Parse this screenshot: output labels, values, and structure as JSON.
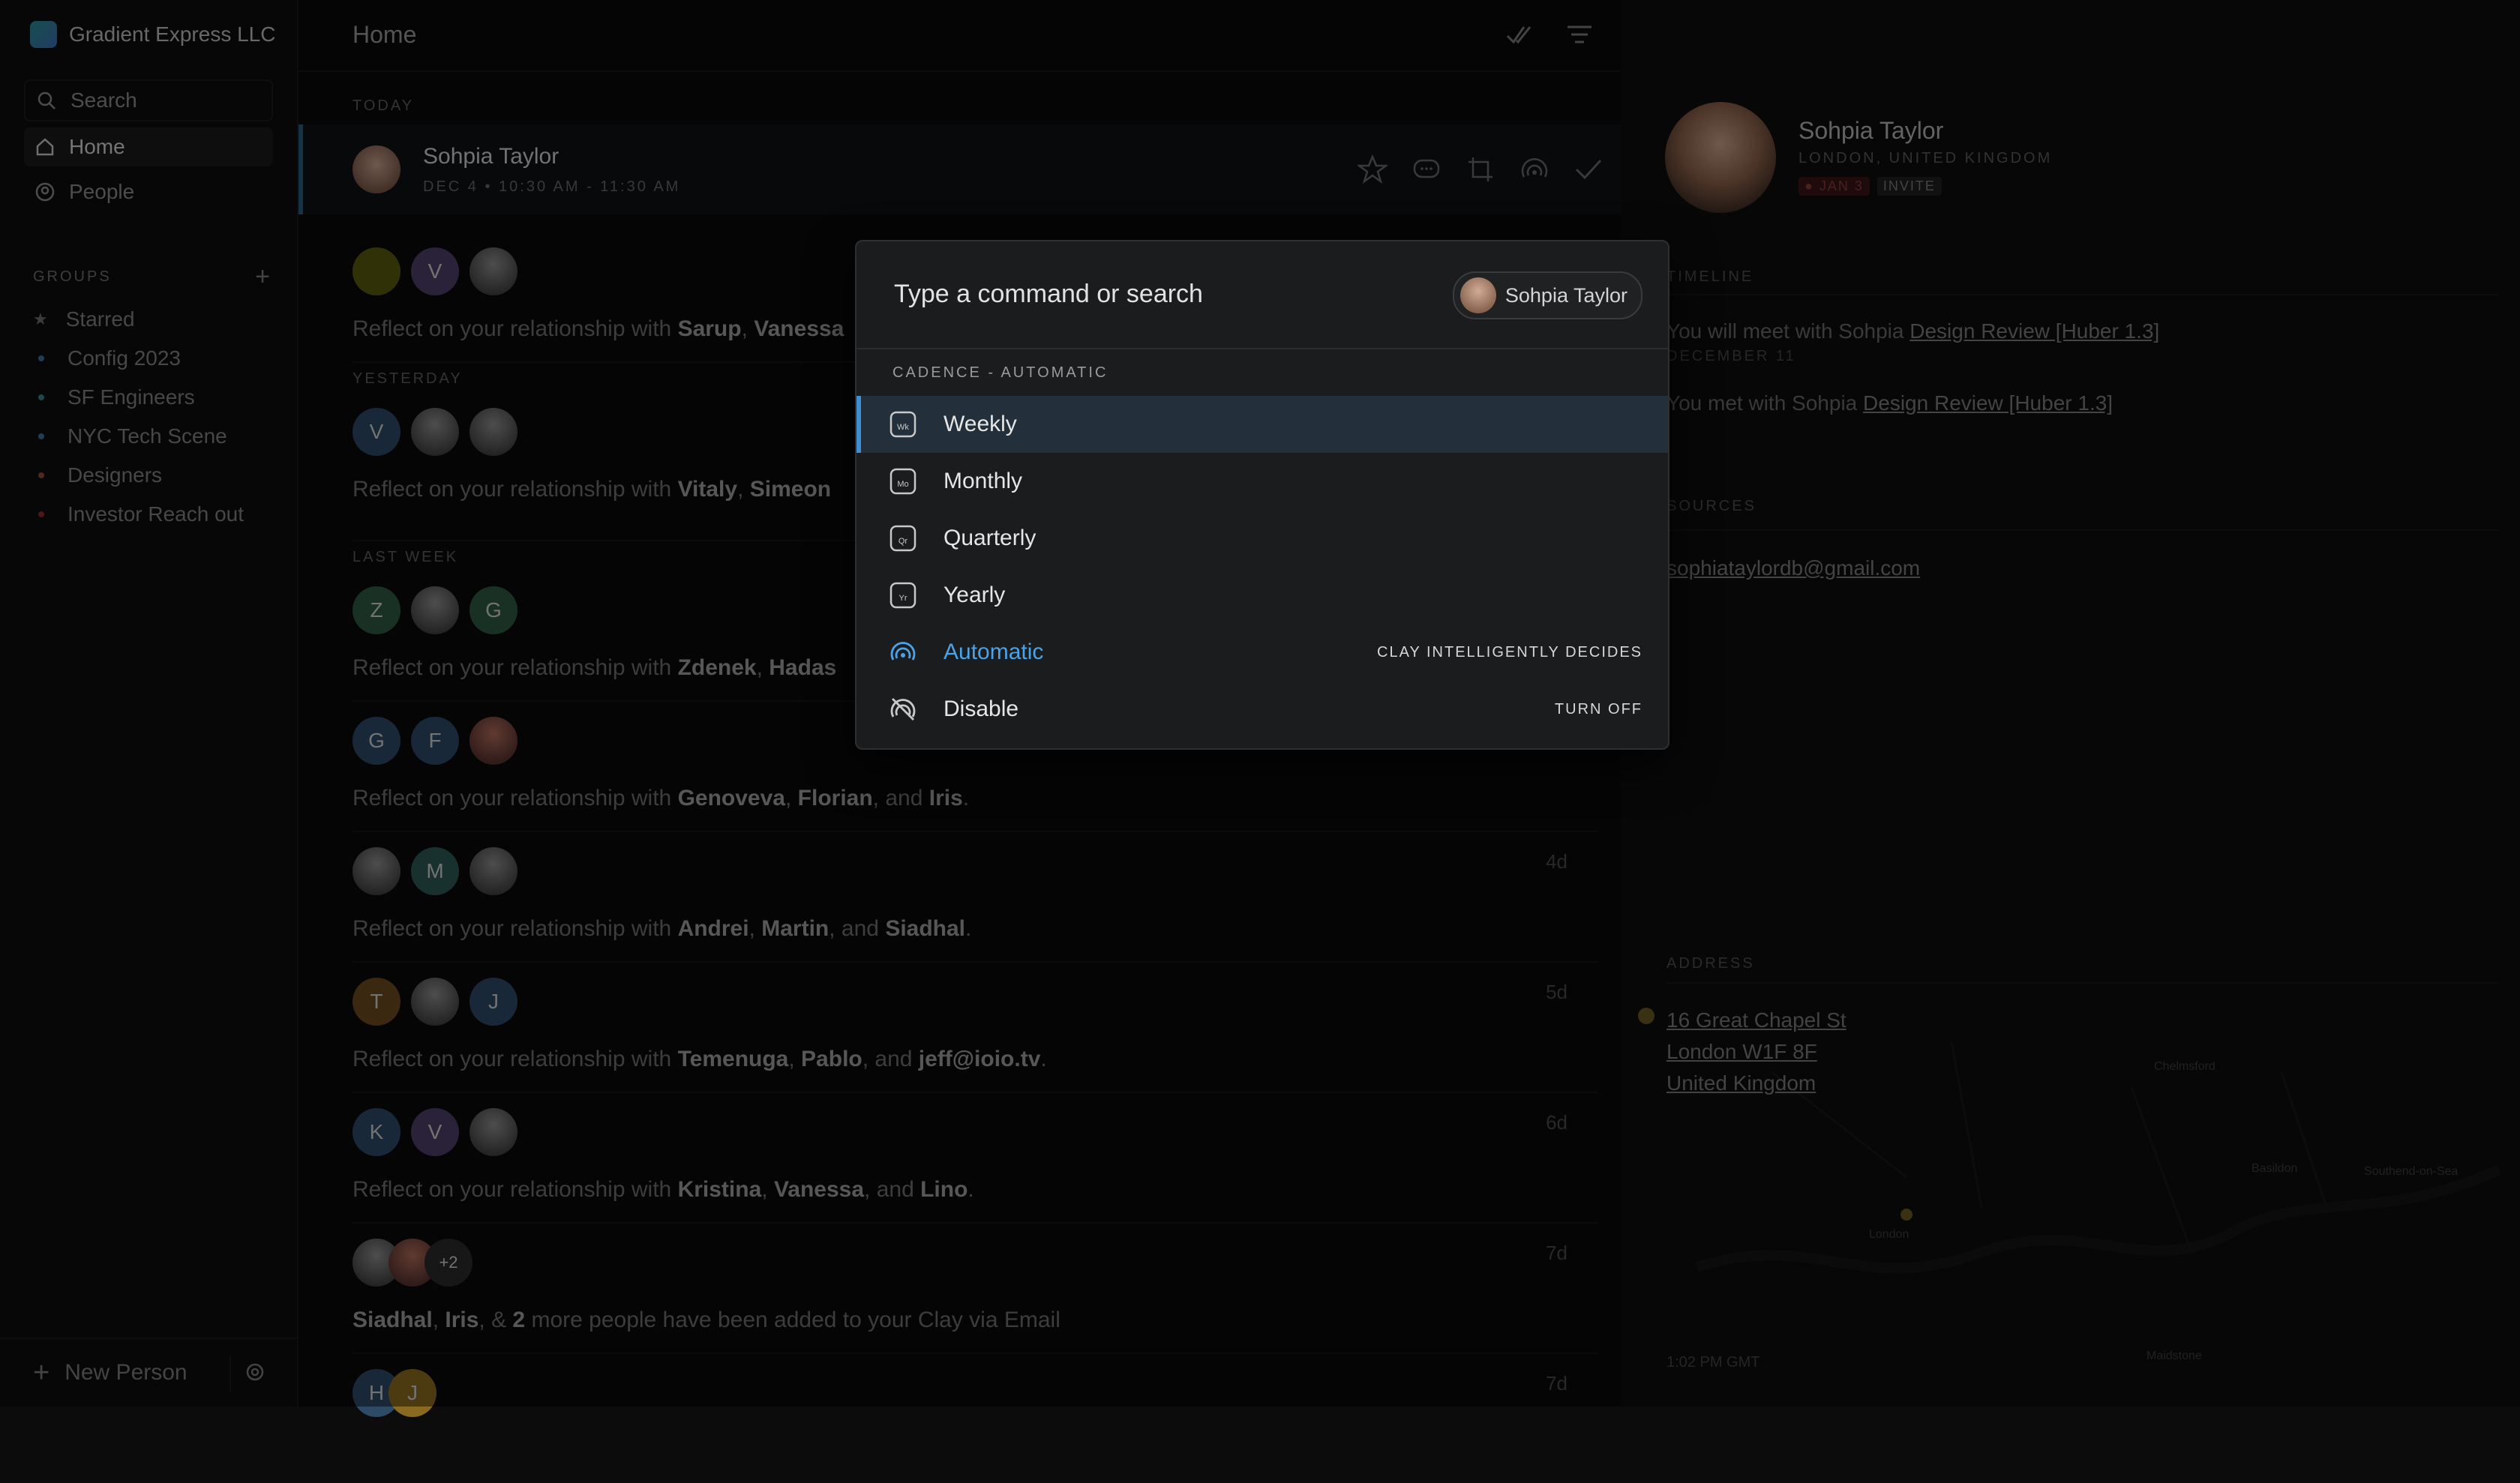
{
  "sidebar": {
    "brand": "Gradient Express LLC",
    "nav": [
      {
        "label": "Search",
        "icon": "search-icon"
      },
      {
        "label": "Home",
        "icon": "home-icon"
      },
      {
        "label": "People",
        "icon": "people-icon"
      }
    ],
    "groups_title": "GROUPS",
    "groups": [
      {
        "label": "Starred",
        "color": "#6e6e6e"
      },
      {
        "label": "Config 2023",
        "color": "#3b6fa0"
      },
      {
        "label": "SF Engineers",
        "color": "#3b7f8f"
      },
      {
        "label": "NYC Tech Scene",
        "color": "#3f6f9a"
      },
      {
        "label": "Designers",
        "color": "#8a4a3a"
      },
      {
        "label": "Investor Reach out",
        "color": "#8a2a2a"
      }
    ],
    "new_person": "New Person"
  },
  "header": {
    "title": "Home"
  },
  "feed": {
    "today_label": "TODAY",
    "today": {
      "name": "Sohpia Taylor",
      "time": "DEC 4 • 10:30 AM - 11:30 AM"
    },
    "items": [
      {
        "prefix": "Reflect on your relationship with",
        "n1": "Sarup",
        "n2": "Vanessa",
        "n3": "",
        "age": "",
        "avatars": [
          "",
          "V",
          ""
        ]
      },
      {
        "section": "YESTERDAY",
        "prefix": "Reflect on your relationship with",
        "n1": "Vitaly",
        "n2": "Simeon",
        "n3": "",
        "age": "",
        "avatars": [
          "V",
          "",
          ""
        ]
      },
      {
        "section": "LAST WEEK",
        "prefix": "Reflect on your relationship with",
        "n1": "Zdenek",
        "n2": "Hadas",
        "n3": "",
        "age": "",
        "avatars": [
          "Z",
          "",
          "G"
        ]
      },
      {
        "prefix": "Reflect on your relationship with",
        "n1": "Genoveva",
        "n2": "Florian",
        "n3": "Iris",
        "age": "",
        "avatars": [
          "G",
          "F",
          ""
        ]
      },
      {
        "prefix": "Reflect on your relationship with",
        "n1": "Andrei",
        "n2": "Martin",
        "n3": "Siadhal",
        "age": "4d",
        "avatars": [
          "",
          "M",
          ""
        ]
      },
      {
        "prefix": "Reflect on your relationship with",
        "n1": "Temenuga",
        "n2": "Pablo",
        "n3": "jeff@ioio.tv",
        "age": "5d",
        "avatars": [
          "T",
          "",
          "J"
        ]
      },
      {
        "prefix": "Reflect on your relationship with",
        "n1": "Kristina",
        "n2": "Vanessa",
        "n3": "Lino",
        "age": "6d",
        "avatars": [
          "K",
          "V",
          ""
        ]
      },
      {
        "prefix": "",
        "n1": "Siadhal",
        "n2": "Iris",
        "n3": "2",
        "suffix": "more people have been added to your Clay via Email",
        "age": "7d",
        "avatars": [
          "",
          "",
          "+2"
        ]
      },
      {
        "prefix": "",
        "n1": "",
        "n2": "",
        "n3": "",
        "age": "7d",
        "avatars": [
          "H",
          "J"
        ]
      }
    ]
  },
  "profile": {
    "name": "Sohpia Taylor",
    "location": "LONDON, UNITED KINGDOM",
    "badge_date": "JAN 3",
    "badge_invite": "INVITE",
    "timeline_title": "TIMELINE",
    "timeline": [
      {
        "text": "You will meet with Sohpia",
        "link": "Design Review [Huber 1.3]",
        "date": "DECEMBER 11"
      },
      {
        "text": "You met with Sohpia",
        "link": "Design Review [Huber 1.3]",
        "date": ""
      }
    ],
    "sources_title": "SOURCES",
    "email": "sophiataylordb@gmail.com",
    "address_title": "ADDRESS",
    "address": [
      "16 Great Chapel St",
      "London W1F 8F",
      "United Kingdom"
    ],
    "map_time": "1:02 PM GMT",
    "map_labels": [
      "London",
      "Chelmsford",
      "Basildon",
      "Southend-on-Sea",
      "Maidstone"
    ]
  },
  "command": {
    "placeholder": "Type a command or search",
    "chip": "Sohpia Taylor",
    "section": "CADENCE - AUTOMATIC",
    "options": [
      {
        "label": "Weekly",
        "abbr": "Wk",
        "hint": ""
      },
      {
        "label": "Monthly",
        "abbr": "Mo",
        "hint": ""
      },
      {
        "label": "Quarterly",
        "abbr": "Qr",
        "hint": ""
      },
      {
        "label": "Yearly",
        "abbr": "Yr",
        "hint": ""
      },
      {
        "label": "Automatic",
        "abbr": "",
        "hint": "CLAY INTELLIGENTLY DECIDES"
      },
      {
        "label": "Disable",
        "abbr": "",
        "hint": "TURN OFF"
      }
    ]
  },
  "colors": {
    "accent": "#3f8fd0",
    "automatic": "#4aa3e8"
  }
}
